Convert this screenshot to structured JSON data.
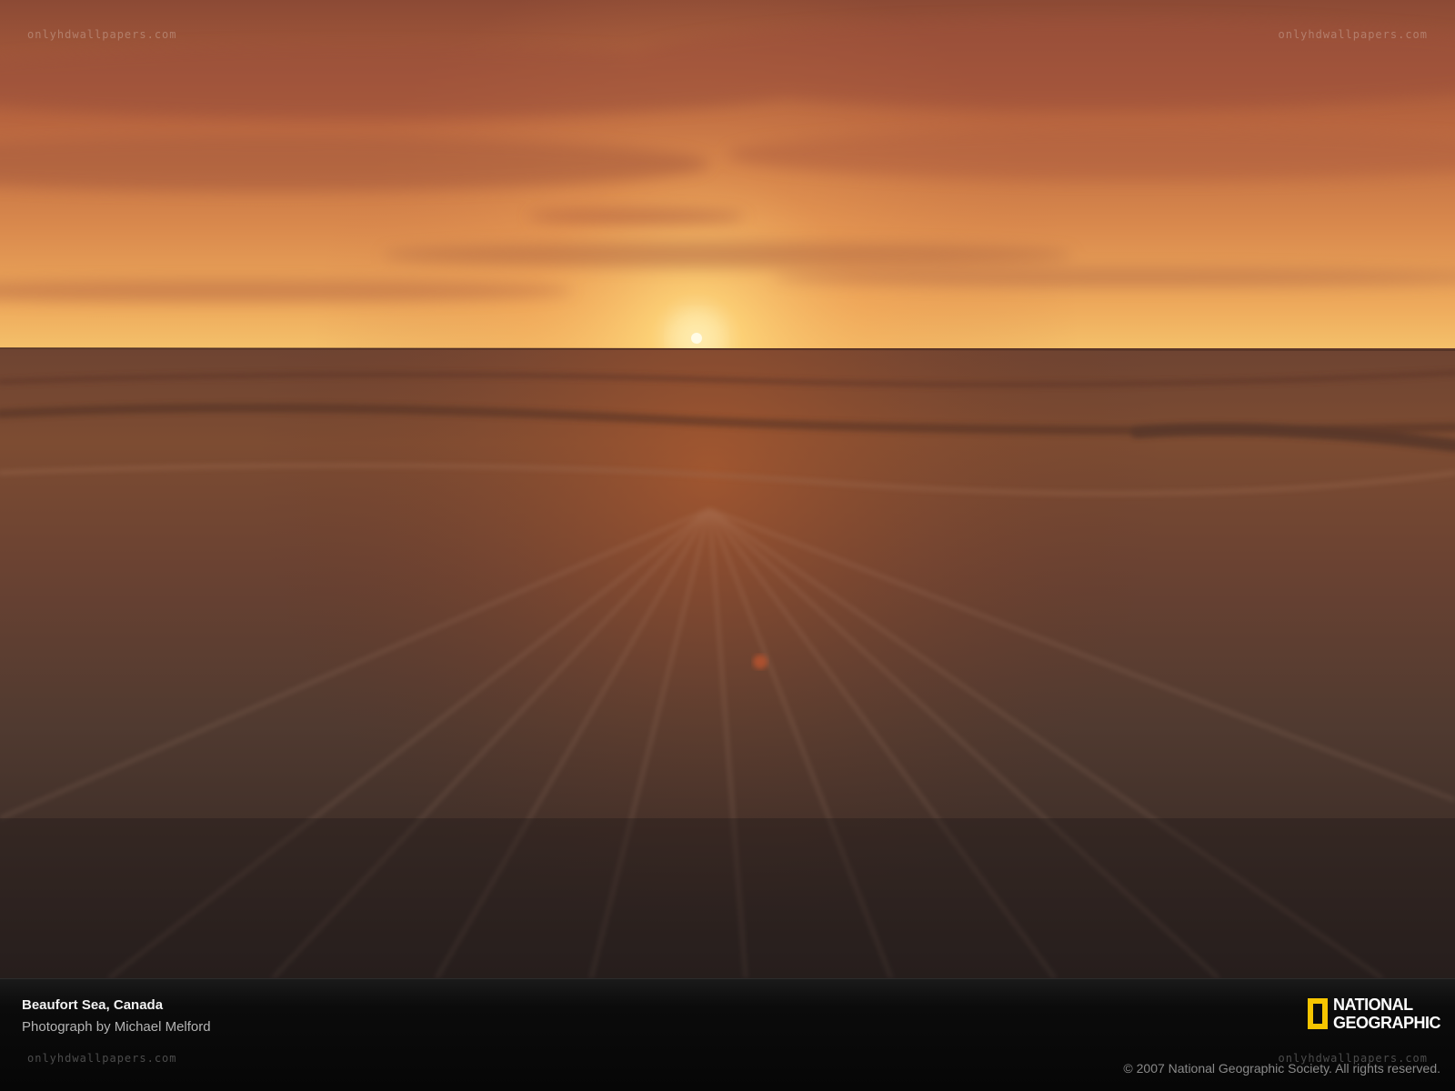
{
  "photo": {
    "subject": "sunset-over-sea",
    "colors": {
      "sky_top": "#a85a3c",
      "sky_mid": "#d98a4e",
      "horizon_glow": "#f6c86a",
      "sun": "#fff6d0",
      "sea_near": "#3a2a22",
      "sea_far": "#7a4a30"
    }
  },
  "caption": {
    "location": "Beaufort Sea, Canada",
    "credit": "Photograph by Michael Melford",
    "copyright": "© 2007 National Geographic Society. All rights reserved."
  },
  "logo": {
    "line1": "NATIONAL",
    "line2": "GEOGRAPHIC",
    "border_color": "#f6c500"
  },
  "watermarks": {
    "top_left": "onlyhdwallpapers.com",
    "top_right": "onlyhdwallpapers.com",
    "bottom_left": "onlyhdwallpapers.com",
    "bottom_right": "onlyhdwallpapers.com"
  }
}
